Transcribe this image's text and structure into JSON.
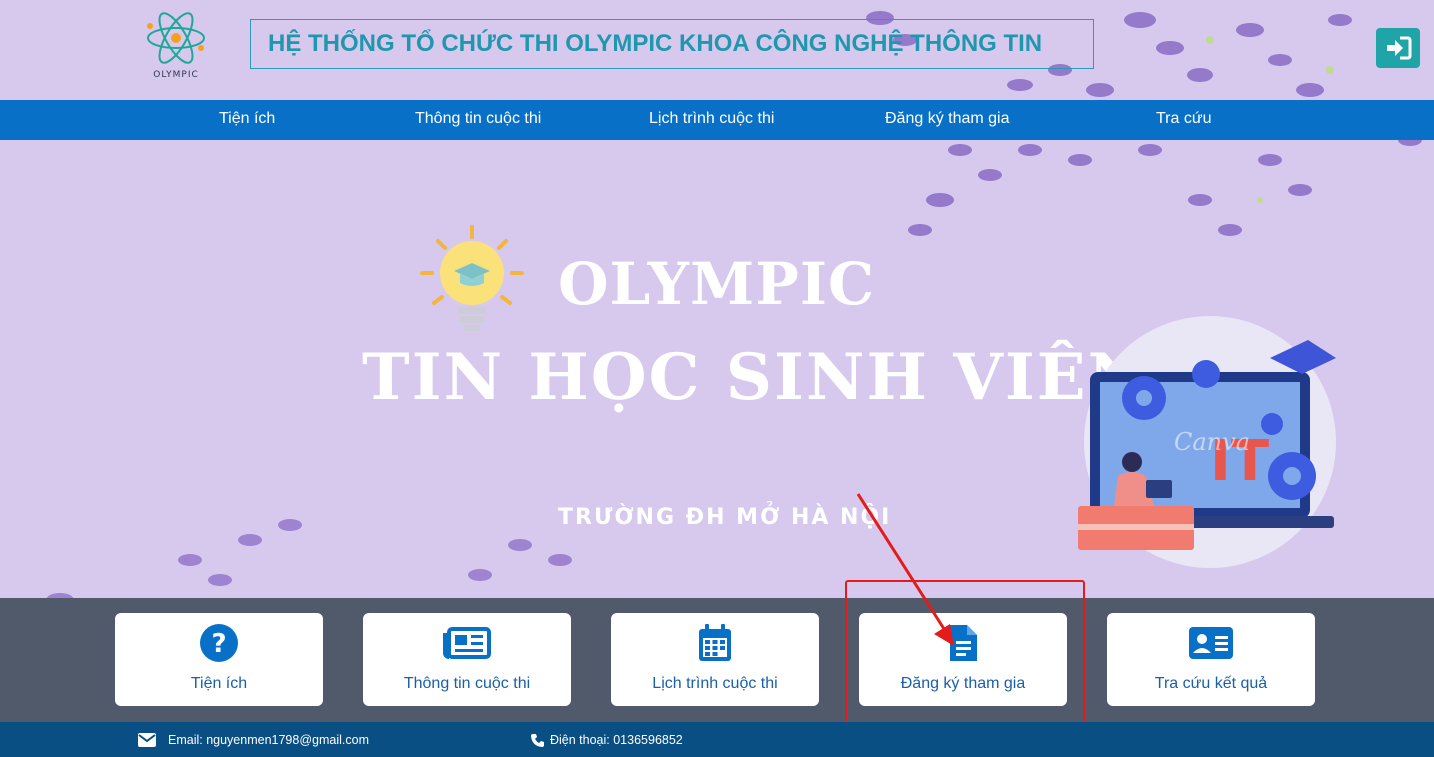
{
  "header": {
    "logo_text": "OLYMPIC",
    "title": "HỆ THỐNG TỔ CHỨC THI OLYMPIC KHOA CÔNG NGHỆ THÔNG TIN"
  },
  "nav": [
    "Tiện ích",
    "Thông tin cuộc thi",
    "Lịch trình cuộc thi",
    "Đăng ký tham gia",
    "Tra cứu"
  ],
  "hero": {
    "line1": "OLYMPIC",
    "line2": "TIN HỌC SINH VIÊN",
    "line3": "TRƯỜNG ĐH MỞ HÀ NỘI",
    "watermark": "Canva",
    "it_text": "IT"
  },
  "cards": [
    {
      "label": "Tiện ích",
      "icon": "question-circle-icon"
    },
    {
      "label": "Thông tin cuộc thi",
      "icon": "newspaper-icon"
    },
    {
      "label": "Lịch trình cuộc thi",
      "icon": "calendar-icon"
    },
    {
      "label": "Đăng ký tham gia",
      "icon": "file-document-icon"
    },
    {
      "label": "Tra cứu kết quả",
      "icon": "id-card-icon"
    }
  ],
  "footer": {
    "email": "Email: nguyenmen1798@gmail.com",
    "phone": "Điện thoại: 0136596852"
  },
  "colors": {
    "background": "#d7c8ee",
    "nav": "#0871c7",
    "title": "#1f97ac",
    "band": "#515a6b",
    "footer": "#094f83",
    "annotation": "#e31b1b"
  }
}
